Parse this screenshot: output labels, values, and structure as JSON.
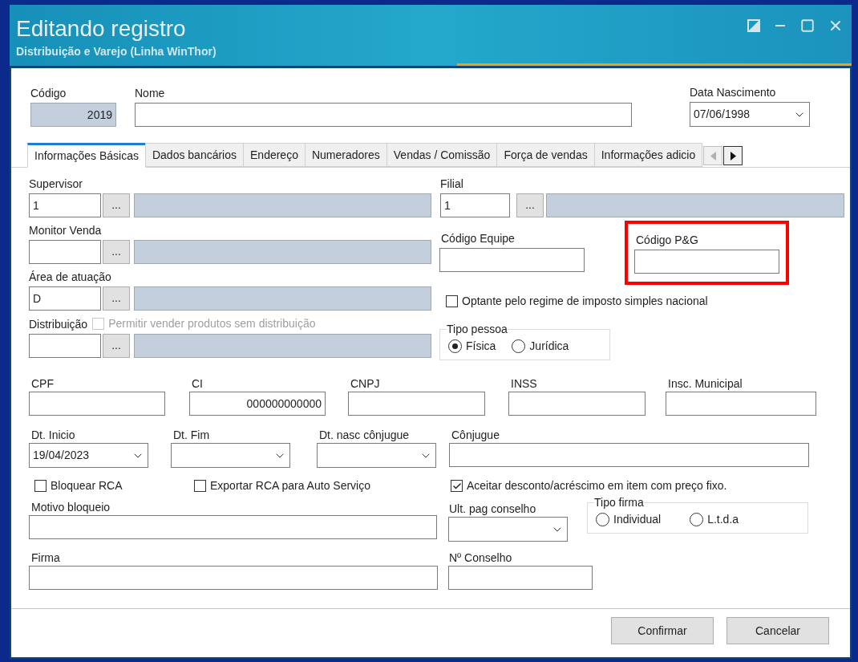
{
  "window": {
    "title": "Editando registro",
    "subtitle": "Distribuição e Varejo (Linha WinThor)"
  },
  "header": {
    "codigo": {
      "label": "Código",
      "value": "2019"
    },
    "nome": {
      "label": "Nome"
    },
    "data_nascimento": {
      "label": "Data Nascimento",
      "value": "07/06/1998"
    }
  },
  "tabs": [
    {
      "label": "Informações Básicas",
      "selected": true
    },
    {
      "label": "Dados bancários",
      "selected": false
    },
    {
      "label": "Endereço",
      "selected": false
    },
    {
      "label": "Numeradores",
      "selected": false
    },
    {
      "label": "Vendas  / Comissão",
      "selected": false
    },
    {
      "label": "Força de vendas",
      "selected": false
    },
    {
      "label": "Informações adicio",
      "selected": false
    }
  ],
  "lookups": [
    {
      "label": "Supervisor",
      "value": "1",
      "browse": "..."
    },
    {
      "label": "Monitor Venda",
      "browse": "..."
    },
    {
      "label": "Área de atuação",
      "value": "D",
      "browse": "..."
    },
    {
      "label": "Distribuição",
      "browse": "...",
      "option": {
        "label": "Permitir vender produtos sem distribuição",
        "checked": false,
        "disabled": true
      }
    }
  ],
  "filial": {
    "label": "Filial",
    "value": "1",
    "browse": "..."
  },
  "codigo_equipe": {
    "label": "Código Equipe"
  },
  "codigo_pg": {
    "label": "Código P&G",
    "highlighted": true
  },
  "optante": {
    "label": "Optante pelo regime de imposto simples nacional",
    "checked": false
  },
  "tipo_pessoa": {
    "label": "Tipo pessoa",
    "options": [
      {
        "label": "Física",
        "selected": true
      },
      {
        "label": "Jurídica",
        "selected": false
      }
    ]
  },
  "doc_fields": [
    {
      "label": "CPF"
    },
    {
      "label": "CI",
      "value": "000000000000"
    },
    {
      "label": "CNPJ"
    },
    {
      "label": "INSS"
    },
    {
      "label": "Insc. Municipal"
    }
  ],
  "date_fields": [
    {
      "label": "Dt. Inicio",
      "value": "19/04/2023",
      "kind": "dropdown"
    },
    {
      "label": "Dt. Fim",
      "kind": "dropdown"
    },
    {
      "label": "Dt. nasc cônjugue",
      "kind": "dropdown"
    },
    {
      "label": "Cônjugue",
      "kind": "text"
    }
  ],
  "checkboxes": [
    {
      "label": "Bloquear RCA",
      "checked": false
    },
    {
      "label": "Exportar RCA para Auto Serviço",
      "checked": false
    },
    {
      "label": "Aceitar desconto/acréscimo em item com preço fixo.",
      "checked": true
    }
  ],
  "motivo_bloqueio": {
    "label": "Motivo bloqueio"
  },
  "ult_pag_conselho": {
    "label": "Ult. pag conselho"
  },
  "tipo_firma": {
    "label": "Tipo firma",
    "options": [
      {
        "label": "Individual",
        "selected": false
      },
      {
        "label": "L.t.d.a",
        "selected": false
      }
    ]
  },
  "firma": {
    "label": "Firma"
  },
  "numero_conselho": {
    "label": "Nº Conselho"
  },
  "buttons": [
    {
      "label": "Confirmar"
    },
    {
      "label": "Cancelar"
    }
  ]
}
